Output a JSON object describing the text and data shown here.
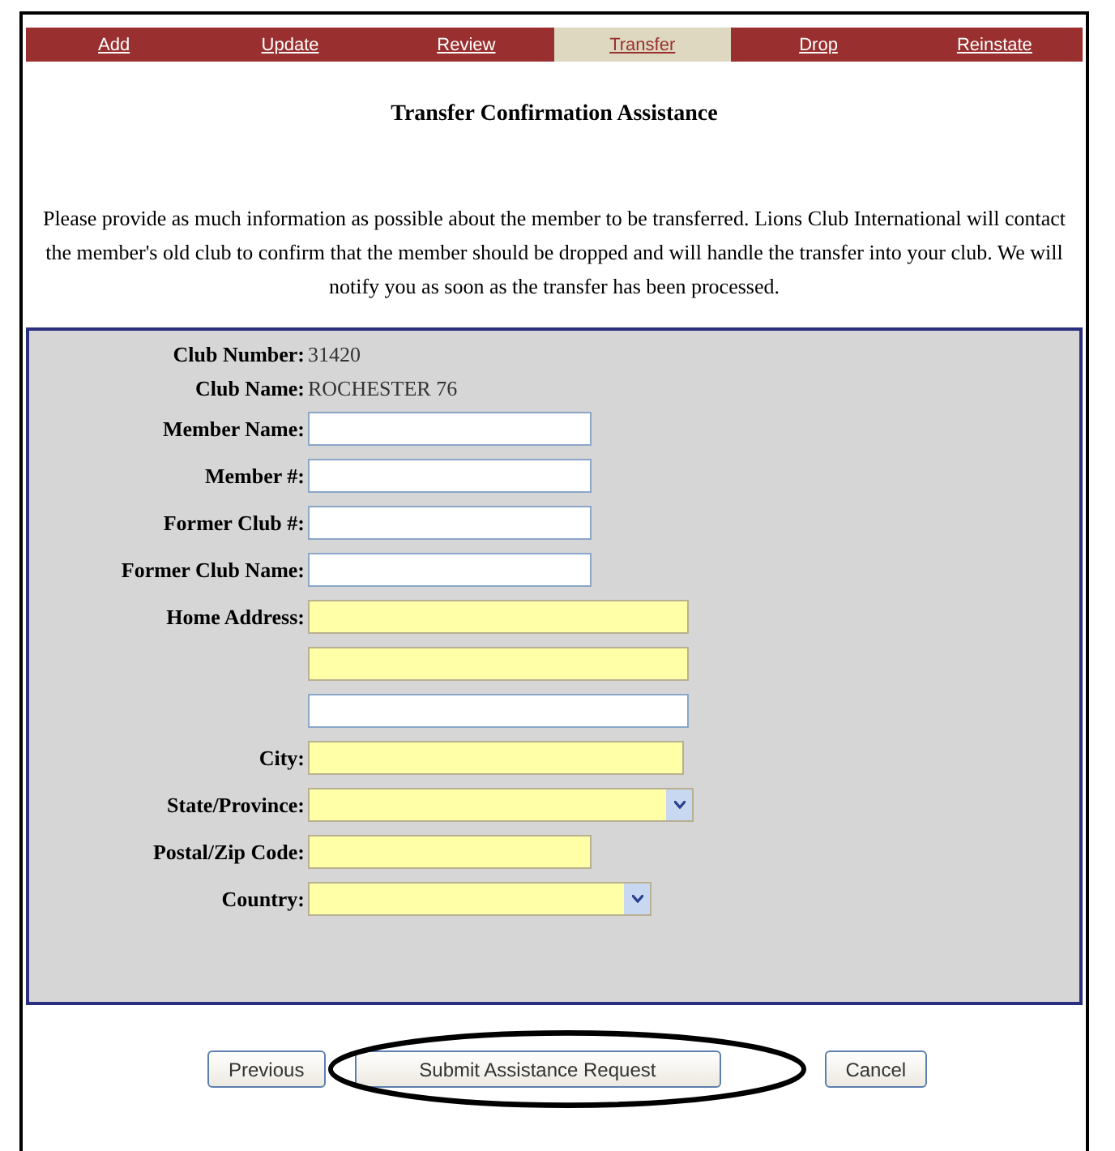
{
  "tabs": [
    {
      "label": "Add",
      "selected": false
    },
    {
      "label": "Update",
      "selected": false
    },
    {
      "label": "Review",
      "selected": false
    },
    {
      "label": "Transfer",
      "selected": true
    },
    {
      "label": "Drop",
      "selected": false
    },
    {
      "label": "Reinstate",
      "selected": false
    }
  ],
  "title": "Transfer Confirmation Assistance",
  "intro": "Please provide as much information as possible about the member to be transferred. Lions Club International will contact the member's old club to confirm that the member should be dropped and will handle the transfer into your club. We will notify you as soon as the transfer has been processed.",
  "info": [
    {
      "label": "Club Number:",
      "value": "31420"
    },
    {
      "label": "Club Name:",
      "value": "ROCHESTER 76"
    }
  ],
  "fields": [
    {
      "label": "Member Name:",
      "kind": "text",
      "required": false
    },
    {
      "label": "Member #:",
      "kind": "text",
      "required": false
    },
    {
      "label": "Former Club #:",
      "kind": "text",
      "required": false
    },
    {
      "label": "Former Club Name:",
      "kind": "text",
      "required": false
    },
    {
      "label": "Home Address:",
      "kind": "text",
      "required": true
    },
    {
      "kind": "text",
      "required": true
    },
    {
      "kind": "text",
      "required": false
    },
    {
      "label": "City:",
      "kind": "text",
      "required": true
    },
    {
      "label": "State/Province:",
      "kind": "select",
      "required": true
    },
    {
      "label": "Postal/Zip Code:",
      "kind": "text",
      "required": true
    },
    {
      "label": "Country:",
      "kind": "select",
      "required": true
    }
  ],
  "buttons": [
    {
      "label": "Previous",
      "highlighted": false
    },
    {
      "label": "Submit Assistance Request",
      "highlighted": true
    },
    {
      "label": "Cancel",
      "highlighted": false
    }
  ]
}
